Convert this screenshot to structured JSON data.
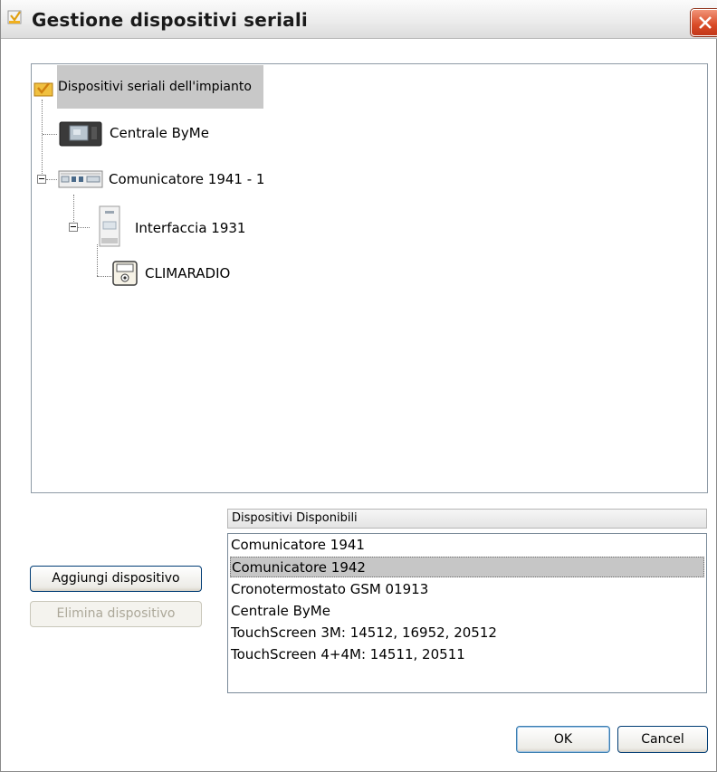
{
  "window": {
    "title": "Gestione dispositivi seriali",
    "close_icon": "close-x-icon"
  },
  "tree": {
    "root": {
      "label": "Dispositivi seriali dell'impianto",
      "icon": "folder-check-icon"
    },
    "nodes": [
      {
        "label": "Centrale ByMe",
        "icon": "central-unit-icon"
      },
      {
        "label": "Comunicatore 1941 - 1",
        "icon": "communicator-device-icon"
      },
      {
        "label": "Interfaccia 1931",
        "icon": "interface-module-icon"
      },
      {
        "label": "CLIMARADIO",
        "icon": "climaradio-icon"
      }
    ]
  },
  "available": {
    "header": "Dispositivi Disponibili",
    "items": [
      "Comunicatore 1941",
      "Comunicatore 1942",
      "Cronotermostato GSM 01913",
      "Centrale ByMe",
      "TouchScreen 3M: 14512, 16952, 20512",
      "TouchScreen 4+4M: 14511, 20511"
    ],
    "selected_index": 1
  },
  "buttons": {
    "add": "Aggiungi dispositivo",
    "delete": "Elimina dispositivo",
    "ok": "OK",
    "cancel": "Cancel"
  },
  "colors": {
    "close_button": "#d94a26",
    "selection": "#c6c6c6"
  }
}
